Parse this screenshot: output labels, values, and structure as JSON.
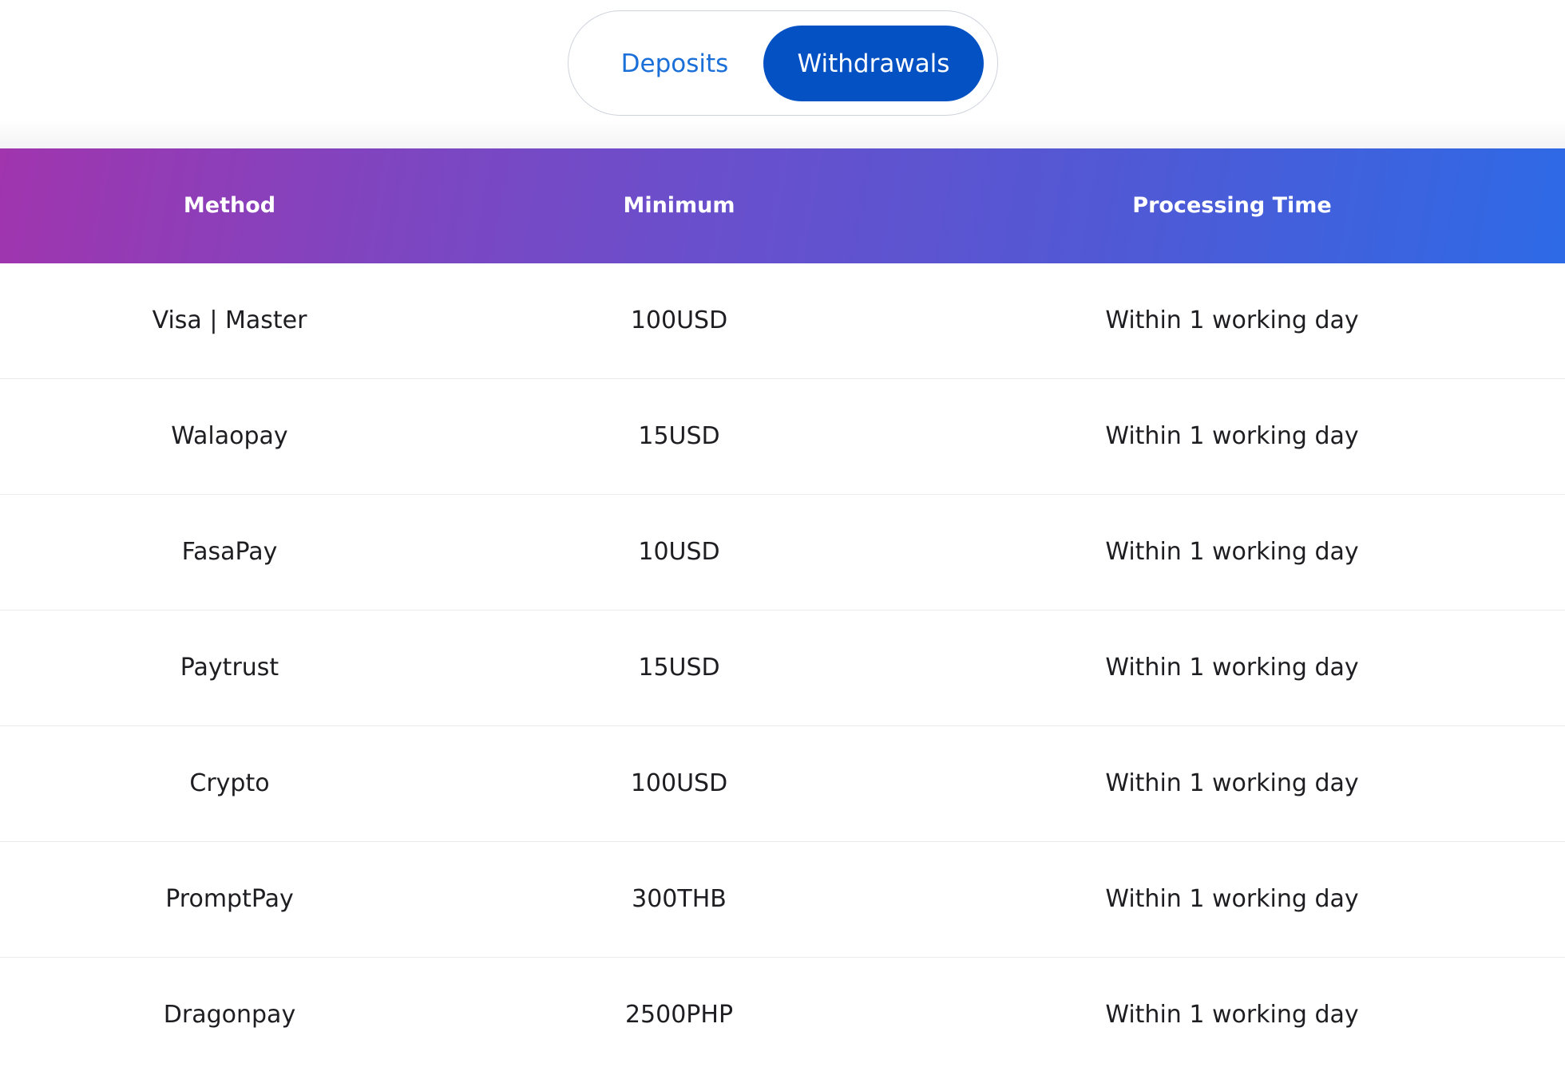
{
  "toggle": {
    "deposits_label": "Deposits",
    "withdrawals_label": "Withdrawals",
    "active": "Withdrawals"
  },
  "table": {
    "headers": [
      "Method",
      "Minimum",
      "Processing Time"
    ],
    "rows": [
      {
        "method": "Visa | Master",
        "minimum": "100USD",
        "processing_time": "Within 1 working day"
      },
      {
        "method": "Walaopay",
        "minimum": "15USD",
        "processing_time": "Within 1 working day"
      },
      {
        "method": "FasaPay",
        "minimum": "10USD",
        "processing_time": "Within 1 working day"
      },
      {
        "method": "Paytrust",
        "minimum": "15USD",
        "processing_time": "Within 1 working day"
      },
      {
        "method": "Crypto",
        "minimum": "100USD",
        "processing_time": "Within 1 working day"
      },
      {
        "method": "PromptPay",
        "minimum": "300THB",
        "processing_time": "Within 1 working day"
      },
      {
        "method": "Dragonpay",
        "minimum": "2500PHP",
        "processing_time": "Within 1 working day"
      }
    ]
  },
  "colors": {
    "active_tab_bg": "#0451c4",
    "inactive_tab_text": "#1a6fd8",
    "header_gradient_start": "#a035ae",
    "header_gradient_end": "#2e6ae6",
    "body_text": "#1e1e22"
  }
}
